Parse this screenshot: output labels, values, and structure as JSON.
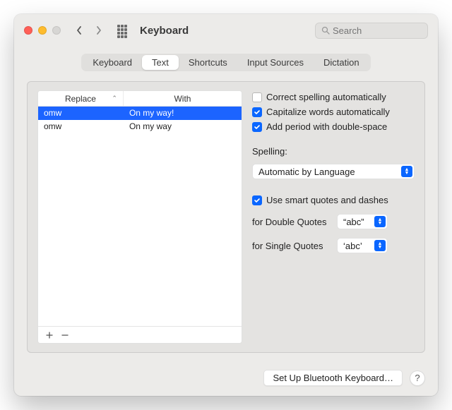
{
  "window": {
    "title": "Keyboard"
  },
  "toolbar": {
    "search_placeholder": "Search"
  },
  "tabs": [
    "Keyboard",
    "Text",
    "Shortcuts",
    "Input Sources",
    "Dictation"
  ],
  "active_tab_index": 1,
  "replace_table": {
    "columns": {
      "replace": "Replace",
      "with": "With"
    },
    "rows": [
      {
        "replace": "omw",
        "with": "On my way!",
        "selected": true
      },
      {
        "replace": "omw",
        "with": "On my way",
        "selected": false
      }
    ]
  },
  "text_settings": {
    "correct_spelling": {
      "label": "Correct spelling automatically",
      "checked": false
    },
    "capitalize_words": {
      "label": "Capitalize words automatically",
      "checked": true
    },
    "add_period": {
      "label": "Add period with double-space",
      "checked": true
    },
    "spelling_label": "Spelling:",
    "spelling_value": "Automatic by Language",
    "smart_quotes": {
      "label": "Use smart quotes and dashes",
      "checked": true
    },
    "double_quotes": {
      "label": "for Double Quotes",
      "value": "“abc”"
    },
    "single_quotes": {
      "label": "for Single Quotes",
      "value": "‘abc’"
    }
  },
  "footer": {
    "bluetooth_button": "Set Up Bluetooth Keyboard…",
    "help": "?"
  }
}
